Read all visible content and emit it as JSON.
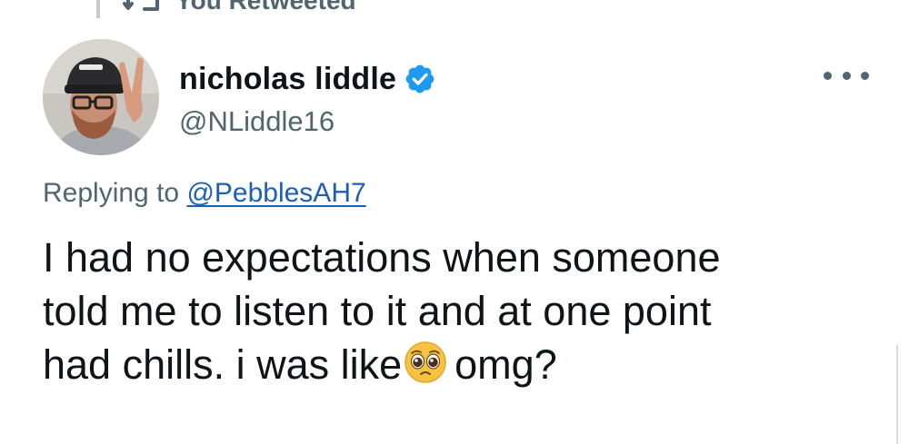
{
  "retweet_banner": {
    "label": "You Retweeted",
    "icon": "retweet-icon"
  },
  "author": {
    "display_name": "nicholas liddle",
    "handle": "@NLiddle16",
    "verified": true,
    "verified_icon": "verified-badge-icon",
    "avatar_icon": "avatar"
  },
  "menu": {
    "icon": "more-options-icon"
  },
  "reply_context": {
    "prefix": "Replying to",
    "target": "@PebblesAH7"
  },
  "tweet": {
    "line1": "I had no expectations when someone",
    "line2": "told me to listen to it and at one point",
    "line3_before": "had chills. i was like",
    "emoji_icon": "pleading-face-emoji",
    "line3_after": "omg?"
  },
  "colors": {
    "text": "#0f1419",
    "secondary": "#536471",
    "link": "#1d5fb3",
    "verified": "#1d9bf0"
  }
}
